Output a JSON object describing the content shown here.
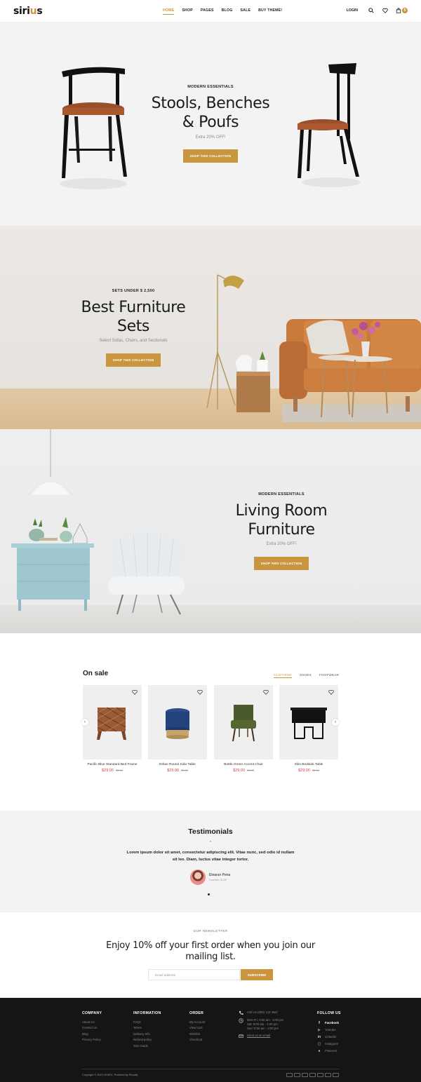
{
  "header": {
    "logo": {
      "pre": "siri",
      "accent": "u",
      "post": "s"
    },
    "nav": [
      {
        "label": "HOME",
        "active": true
      },
      {
        "label": "SHOP"
      },
      {
        "label": "PAGES"
      },
      {
        "label": "BLOG"
      },
      {
        "label": "SALE"
      },
      {
        "label": "BUY THEME!"
      }
    ],
    "login_label": "LOGIN",
    "cart_count": "0"
  },
  "banners": [
    {
      "kicker": "MODERN ESSENTIALS",
      "title_line1": "Stools, Benches",
      "title_line2": "& Poufs",
      "subtitle": "Extra 20% OFF!",
      "button": "SHOP THIS COLLECTION"
    },
    {
      "kicker": "SETS UNDER $ 2,500",
      "title_line1": "Best Furniture",
      "title_line2": "Sets",
      "subtitle": "Select Sofas, Chairs, and Sectionals",
      "button": "SHOP THIS COLLECTION"
    },
    {
      "kicker": "MODERN ESSENTIALS",
      "title_line1": "Living Room",
      "title_line2": "Furniture",
      "subtitle": "Extra 20% OFF!",
      "button": "SHOP THIS COLLECTION"
    }
  ],
  "on_sale": {
    "title": "On sale",
    "tabs": [
      {
        "label": "CLOTHING",
        "active": true
      },
      {
        "label": "SHOES"
      },
      {
        "label": "FOOTWEAR"
      }
    ],
    "products": [
      {
        "name": "Pacific Blue Standard Bed Frame",
        "price": "$29.00",
        "old_price": "35.00"
      },
      {
        "name": "Ethan Round Side Table",
        "price": "$29.00",
        "old_price": "35.00"
      },
      {
        "name": "Bottle Green Accent Chair",
        "price": "$29.00",
        "old_price": "35.00"
      },
      {
        "name": "Slim Bedside Table",
        "price": "$29.00",
        "old_price": "35.00"
      }
    ]
  },
  "testimonials": {
    "title": "Testimonials",
    "quote_mark": "”",
    "text": "Lorem ipsum dolor sit amet, consectetur adipiscing elit. Vitae nunc, sed odio id nullam sit leo. Diam, luctus vitae integer tortor.",
    "name": "Eleanor Pena",
    "role": "Founder GLOF"
  },
  "newsletter": {
    "kicker": "OUR NEWSLETTER",
    "title": "Enjoy 10% off your first order when you join our mailing list.",
    "placeholder": "Email address",
    "button": "SUBSCRIBE"
  },
  "footer": {
    "company": {
      "title": "COMPANY",
      "links": [
        "About Us",
        "Contact Us",
        "Blog",
        "Privacy Policy"
      ]
    },
    "information": {
      "title": "INFORMATION",
      "links": [
        "FAQs",
        "Terms",
        "Delivery Info",
        "Refund policy",
        "Size Guide"
      ]
    },
    "order": {
      "title": "ORDER",
      "links": [
        "My Account",
        "View Cart",
        "Wishlist",
        "Checkout"
      ]
    },
    "contact": {
      "phone": "Call Us (800) 123 4567",
      "hours": [
        "Mon-Fri: 9:00 am - 6:00 pm",
        "Sat: 9:00 am - 4:00 pm",
        "Sun: 9:00 am - 2:00 pm"
      ],
      "email": "Send us an email"
    },
    "follow": {
      "title": "FOLLOW US",
      "links": [
        "Facebook",
        "Youtube",
        "LinkedIn",
        "Instagram",
        "Pinterest"
      ]
    },
    "copyright": "Copyright © 2023 VENEX. Powered by Shopify"
  },
  "colors": {
    "accent": "#c9963f",
    "sale_price": "#d13e3e",
    "footer_bg": "#151515"
  }
}
